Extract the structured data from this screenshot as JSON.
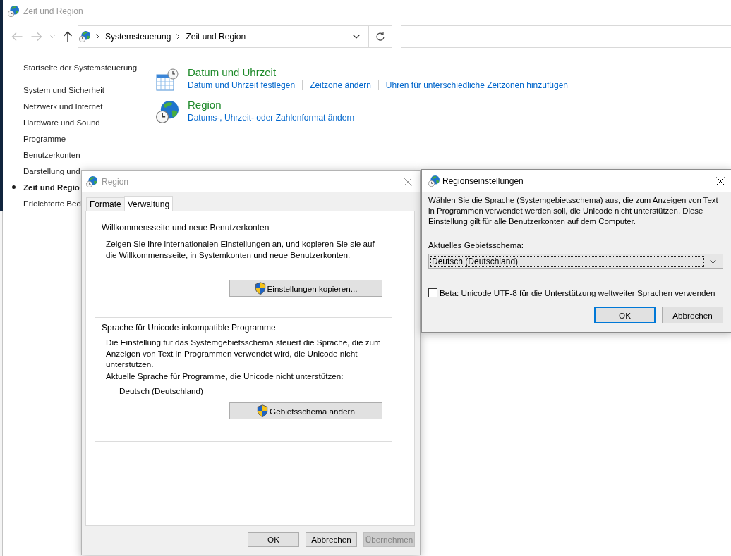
{
  "window": {
    "title": "Zeit und Region",
    "active": false
  },
  "navigation": {
    "back": {
      "disabled": true
    },
    "forward": {
      "disabled": true
    },
    "breadcrumbs": [
      "Systemsteuerung",
      "Zeit und Region"
    ]
  },
  "sidebar": {
    "home": "Startseite der Systemsteuerung",
    "items": [
      {
        "label": "System und Sicherheit",
        "selected": false
      },
      {
        "label": "Netzwerk und Internet",
        "selected": false
      },
      {
        "label": "Hardware und Sound",
        "selected": false
      },
      {
        "label": "Programme",
        "selected": false
      },
      {
        "label": "Benutzerkonten",
        "selected": false
      },
      {
        "label": "Darstellung und",
        "selected": false
      },
      {
        "label": "Zeit und Regio",
        "selected": true
      },
      {
        "label": "Erleichterte Bed",
        "selected": false
      }
    ]
  },
  "categories": [
    {
      "kind": "datetime",
      "title": "Datum und Uhrzeit",
      "links": [
        "Datum und Uhrzeit festlegen",
        "Zeitzone ändern",
        "Uhren für unterschiedliche Zeitzonen hinzufügen"
      ]
    },
    {
      "kind": "region",
      "title": "Region",
      "links": [
        "Datums-, Uhrzeit- oder Zahlenformat ändern"
      ]
    }
  ],
  "region_dialog": {
    "title": "Region",
    "active": false,
    "tabs": [
      {
        "label": "Formate",
        "selected": false
      },
      {
        "label": "Verwaltung",
        "selected": true
      }
    ],
    "groups": [
      {
        "title": "Willkommensseite und neue Benutzerkonten",
        "paragraphs": [
          "Zeigen Sie Ihre internationalen Einstellungen an, und kopieren Sie sie auf die Willkommensseite, in Systemkonten und neue Benutzerkonten."
        ],
        "button": {
          "label": "Einstellungen kopieren...",
          "shield": true
        }
      },
      {
        "title": "Sprache für Unicode-inkompatible Programme",
        "paragraphs": [
          "Die Einstellung für das Systemgebietsschema steuert die Sprache, die zum Anzeigen von Text in Programmen verwendet wird, die Unicode nicht unterstützen.",
          "Aktuelle Sprache für Programme, die Unicode nicht unterstützen:"
        ],
        "value": "Deutsch (Deutschland)",
        "button": {
          "label": "Gebietsschema ändern",
          "shield": true
        }
      }
    ],
    "buttons": [
      {
        "label": "OK",
        "disabled": false
      },
      {
        "label": "Abbrechen",
        "disabled": false
      },
      {
        "label": "Übernehmen",
        "disabled": true
      }
    ]
  },
  "settings_dialog": {
    "title": "Regionseinstellungen",
    "active": true,
    "text": "Wählen Sie die Sprache (Systemgebietsschema) aus, die zum Anzeigen von Text in Programmen verwendet werden soll, die Unicode nicht unterstützen. Diese Einstellung gilt für alle Benutzerkonten auf dem Computer.",
    "locale_label": {
      "access_key": "A",
      "rest": "ktuelles Gebietsschema:"
    },
    "locale_select": {
      "value": "Deutsch (Deutschland)",
      "focused": true
    },
    "utf8_option": {
      "before": "Beta: ",
      "access_key": "U",
      "rest": "nicode UTF-8 für die Unterstützung weltweiter Sprachen verwenden",
      "checked": false
    },
    "buttons": [
      {
        "label": "OK",
        "default": true
      },
      {
        "label": "Abbrechen",
        "default": false
      }
    ]
  }
}
